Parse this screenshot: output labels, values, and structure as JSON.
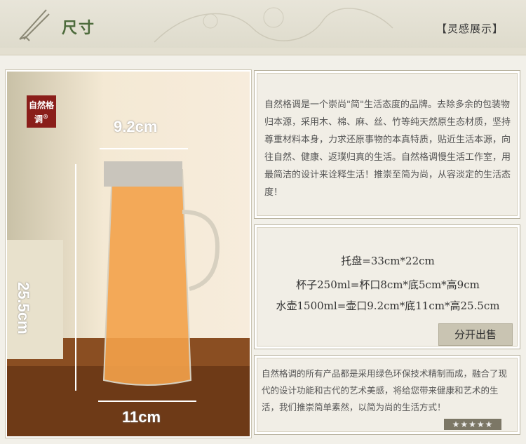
{
  "header": {
    "title": "尺寸",
    "link": "【灵感展示】"
  },
  "photo": {
    "logo_text": "自然格调",
    "logo_mark": "®",
    "width_top": "9.2cm",
    "height": "25.5cm",
    "width_bottom": "11cm"
  },
  "intro": {
    "text": "自然格调是一个崇尚\"简\"生活态度的品牌。去除多余的包装物归本源，采用木、棉、麻、丝、竹等纯天然原生态材质，坚持尊重材料本身，力求还原事物的本真特质，贴近生活本源，向往自然、健康、返璞归真的生活。自然格调慢生活工作室，用最简洁的设计来诠释生活！推崇至简为尚，从容淡定的生活态度！"
  },
  "specs": {
    "tray": "托盘=33cm*22cm",
    "cup": "杯子250ml=杯口8cm*底5cm*高9cm",
    "pot": "水壶1500ml=壶口9.2cm*底11cm*高25.5cm",
    "sell_label": "分开出售"
  },
  "about": {
    "text": "自然格调的所有产品都是采用绿色环保技术精制而成，融合了现代的设计功能和古代的艺术美感，将给您带来健康和艺术的生活，我们推崇简单素然，以简为尚的生活方式！",
    "stars": "★★★★★"
  }
}
